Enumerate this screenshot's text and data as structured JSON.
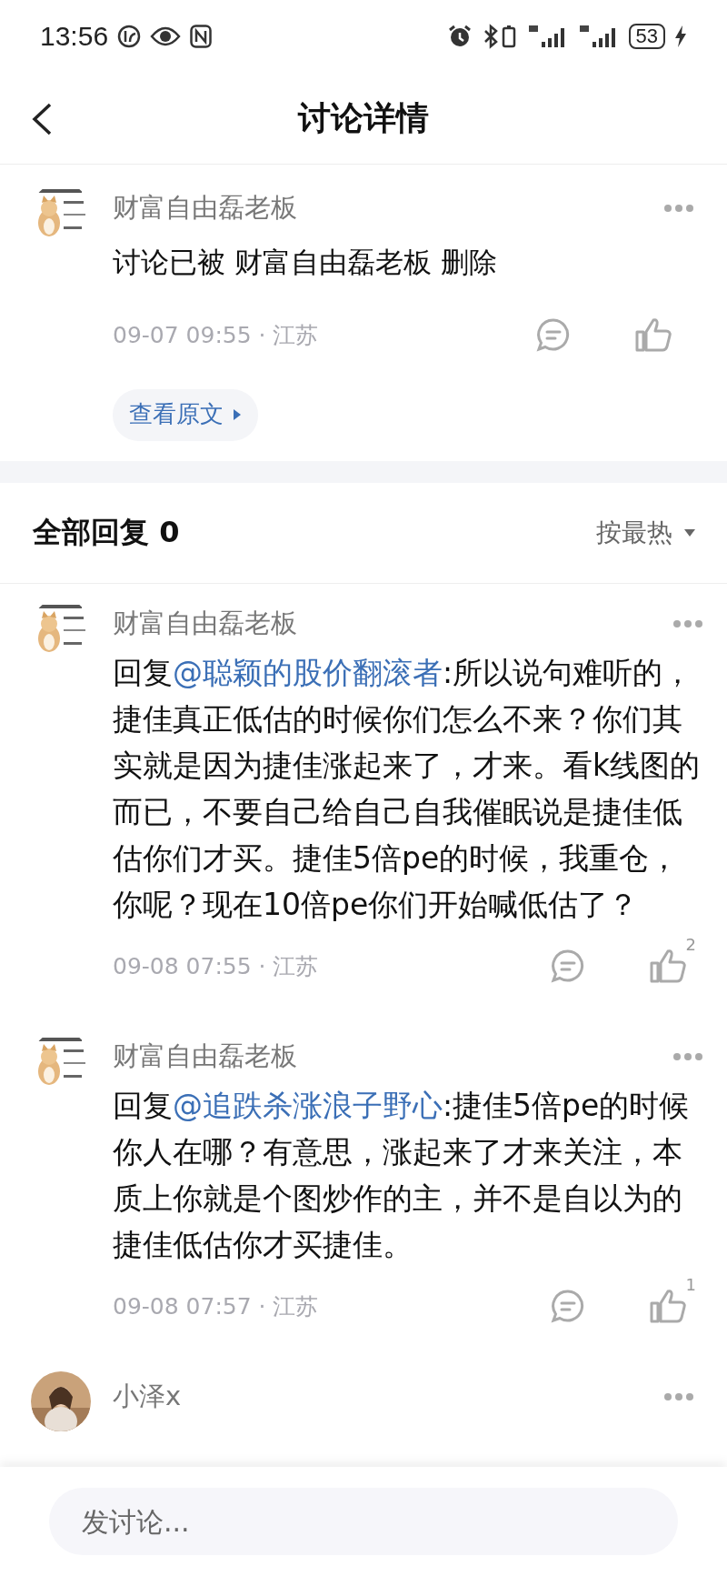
{
  "status_bar": {
    "time": "13:56",
    "battery": "53"
  },
  "nav": {
    "title": "讨论详情"
  },
  "post": {
    "author": "财富自由磊老板",
    "content": "讨论已被 财富自由磊老板 删除",
    "meta": "09-07 09:55 · 江苏",
    "view_original": "查看原文"
  },
  "replies_header": {
    "title": "全部回复 0",
    "sort": "按最热"
  },
  "comments": [
    {
      "author": "财富自由磊老板",
      "prefix": "回复",
      "mention": "@聪颖的股价翻滚者",
      "text": ":所以说句难听的，捷佳真正低估的时候你们怎么不来？你们其实就是因为捷佳涨起来了，才来。看k线图的而已，不要自己给自己自我催眠说是捷佳低估你们才买。捷佳5倍pe的时候，我重仓，你呢？现在10倍pe你们开始喊低估了？",
      "meta": "09-08 07:55 · 江苏",
      "likes": "2"
    },
    {
      "author": "财富自由磊老板",
      "prefix": "回复",
      "mention": "@追跌杀涨浪子野心",
      "text": ":捷佳5倍pe的时候你人在哪？有意思，涨起来了才来关注，本质上你就是个图炒作的主，并不是自以为的捷佳低估你才买捷佳。",
      "meta": "09-08 07:57 · 江苏",
      "likes": "1"
    },
    {
      "author": "小泽x"
    }
  ],
  "composer": {
    "placeholder": "发讨论..."
  }
}
